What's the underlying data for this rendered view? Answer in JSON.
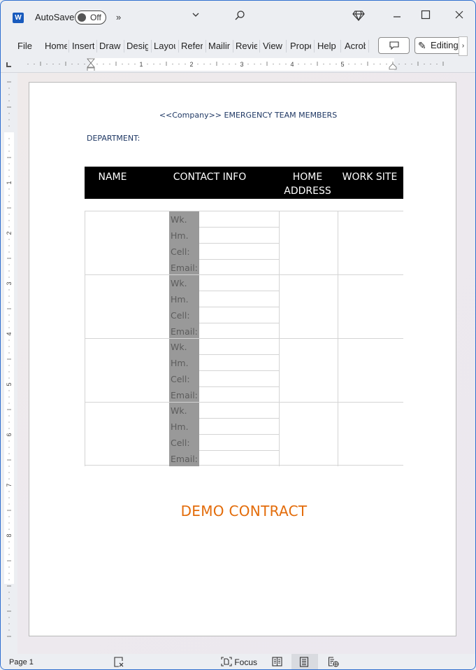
{
  "app": {
    "autosave_label": "AutoSave",
    "autosave_state": "Off",
    "icons": {
      "app_logo": "W",
      "overflow": "»",
      "quick_access": "⌄",
      "search": "⚲",
      "premium": "◇",
      "minimize": "—",
      "maximize": "☐",
      "close": "✕"
    }
  },
  "ribbon": {
    "tabs": [
      {
        "label": "File"
      },
      {
        "label": "Home"
      },
      {
        "label": "Insert"
      },
      {
        "label": "Draw"
      },
      {
        "label": "Design"
      },
      {
        "label": "Layout"
      },
      {
        "label": "References"
      },
      {
        "label": "Mailings"
      },
      {
        "label": "Review"
      },
      {
        "label": "View"
      },
      {
        "label": "Properties"
      },
      {
        "label": "Help"
      },
      {
        "label": "Acrobat"
      }
    ],
    "comment_icon": "▭",
    "editing_label": "Editing",
    "editing_icon": "✎",
    "more_icon": "›"
  },
  "ruler": {
    "horizontal_numbers": [
      "1",
      "2",
      "3",
      "4",
      "5"
    ],
    "vertical_numbers": [
      "1",
      "2",
      "3",
      "4",
      "5",
      "6",
      "7",
      "8"
    ]
  },
  "document": {
    "title": "<<Company>> EMERGENCY TEAM MEMBERS",
    "department_label": "DEPARTMENT:",
    "table_headers": {
      "name": "NAME",
      "contact": "CONTACT INFO",
      "home_line1": "HOME",
      "home_line2": "ADDRESS",
      "work": "WORK SITE"
    },
    "contact_labels": [
      "Wk.",
      "Hm.",
      "Cell:",
      "Email:"
    ],
    "rows": 4,
    "watermark": "DEMO CONTRACT"
  },
  "statusbar": {
    "page": "Page 1",
    "focus_label": "Focus",
    "icons": {
      "proofing": "⊠",
      "focus": "⿴",
      "read_mode": "▥",
      "print_layout": "▤",
      "web_layout": "⊕"
    }
  }
}
